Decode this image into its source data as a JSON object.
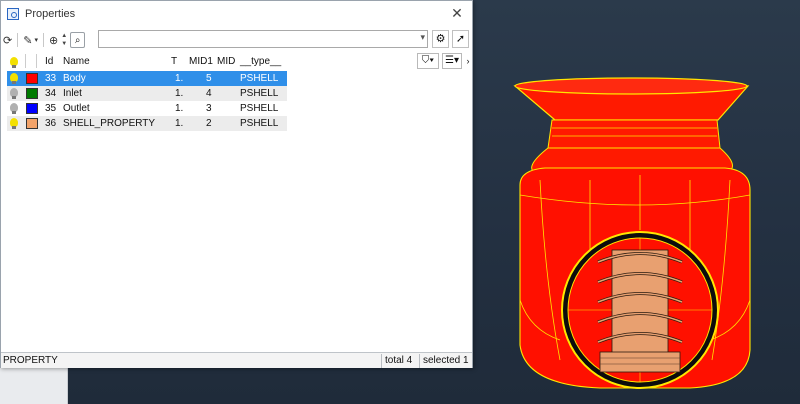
{
  "window": {
    "title": "Properties",
    "close": "✕"
  },
  "toolbar": {
    "refresh_icon": "refresh-icon",
    "brush_icon": "brush-icon",
    "zoom_icon": "magnifier-plus-icon",
    "search_icon": "search-icon",
    "search_value": "",
    "config_icon": "settings-gear-icon",
    "pick_icon": "cursor-pick-icon"
  },
  "table": {
    "headers": [
      "Id",
      "Name",
      "T",
      "MID1",
      "MID",
      "__type__"
    ],
    "rows": [
      {
        "bulb": "#f3e000",
        "color": "#ff0000",
        "id": "33",
        "name": "Body",
        "t": "1.",
        "mid1": "5",
        "mid": "PSHELL",
        "selected": true
      },
      {
        "bulb": "#b0b0b0",
        "color": "#007a00",
        "id": "34",
        "name": "Inlet",
        "t": "1.",
        "mid1": "4",
        "mid": "PSHELL"
      },
      {
        "bulb": "#b0b0b0",
        "color": "#0000ff",
        "id": "35",
        "name": "Outlet",
        "t": "1.",
        "mid1": "3",
        "mid": "PSHELL"
      },
      {
        "bulb": "#f3e000",
        "color": "#f2a36a",
        "id": "36",
        "name": "SHELL_PROPERTY",
        "t": "1.",
        "mid1": "2",
        "mid": "PSHELL"
      }
    ]
  },
  "status": {
    "left": "PROPERTY",
    "total": "total 4",
    "selected": "selected 1"
  },
  "colors": {
    "selection": "#2f8fe9",
    "viewport_bg": "#263342",
    "model_red": "#ff1a00",
    "edge_yellow": "#ffe600",
    "screw": "#e8a070"
  }
}
